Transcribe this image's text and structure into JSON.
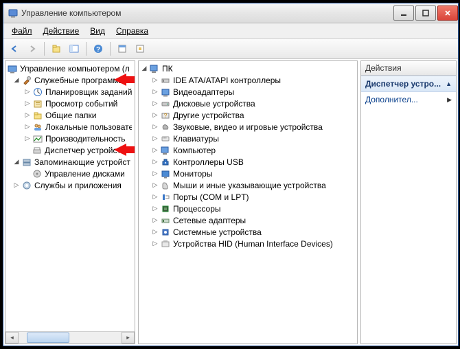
{
  "title": "Управление компьютером",
  "menu": {
    "file": "Файл",
    "action": "Действие",
    "view": "Вид",
    "help": "Справка"
  },
  "left_tree": {
    "root": "Управление компьютером (л",
    "g1_label": "Служебные программы",
    "g1": [
      "Планировщик заданий",
      "Просмотр событий",
      "Общие папки",
      "Локальные пользовате",
      "Производительность",
      "Диспетчер устройств"
    ],
    "g2_label": "Запоминающие устройст",
    "g2": [
      "Управление дисками"
    ],
    "g3_label": "Службы и приложения"
  },
  "mid_tree": {
    "root": "ПК",
    "items": [
      "IDE ATA/ATAPI контроллеры",
      "Видеоадаптеры",
      "Дисковые устройства",
      "Другие устройства",
      "Звуковые, видео и игровые устройства",
      "Клавиатуры",
      "Компьютер",
      "Контроллеры USB",
      "Мониторы",
      "Мыши и иные указывающие устройства",
      "Порты (COM и LPT)",
      "Процессоры",
      "Сетевые адаптеры",
      "Системные устройства",
      "Устройства HID (Human Interface Devices)"
    ]
  },
  "actions_panel": {
    "header": "Действия",
    "section": "Диспетчер устро...",
    "link": "Дополнител..."
  },
  "chart_data": null
}
